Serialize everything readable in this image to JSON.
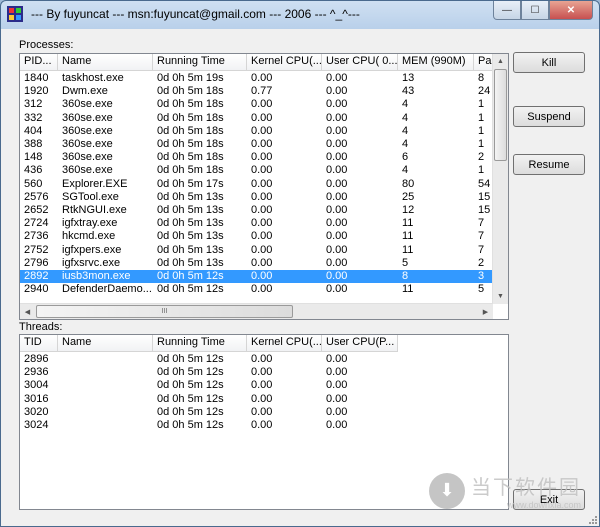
{
  "window": {
    "title": "--- By fuyuncat --- msn:fuyuncat@gmail.com --- 2006 --- ^_^---",
    "icon": "app-icon",
    "minimize_glyph": "—",
    "maximize_glyph": "☐",
    "close_glyph": "✕"
  },
  "processes": {
    "label": "Processes:",
    "columns": [
      "PID...",
      "Name",
      "Running Time",
      "Kernel CPU(...",
      "User CPU( 0...",
      "MEM (990M)",
      "Pa"
    ],
    "rows": [
      [
        "1840",
        "taskhost.exe",
        "0d 0h 5m 19s",
        "0.00",
        "0.00",
        "13",
        "8"
      ],
      [
        "1920",
        "Dwm.exe",
        "0d 0h 5m 18s",
        "0.77",
        "0.00",
        "43",
        "24"
      ],
      [
        "312",
        "360se.exe",
        "0d 0h 5m 18s",
        "0.00",
        "0.00",
        "4",
        "1"
      ],
      [
        "332",
        "360se.exe",
        "0d 0h 5m 18s",
        "0.00",
        "0.00",
        "4",
        "1"
      ],
      [
        "404",
        "360se.exe",
        "0d 0h 5m 18s",
        "0.00",
        "0.00",
        "4",
        "1"
      ],
      [
        "388",
        "360se.exe",
        "0d 0h 5m 18s",
        "0.00",
        "0.00",
        "4",
        "1"
      ],
      [
        "148",
        "360se.exe",
        "0d 0h 5m 18s",
        "0.00",
        "0.00",
        "6",
        "2"
      ],
      [
        "436",
        "360se.exe",
        "0d 0h 5m 18s",
        "0.00",
        "0.00",
        "4",
        "1"
      ],
      [
        "560",
        "Explorer.EXE",
        "0d 0h 5m 17s",
        "0.00",
        "0.00",
        "80",
        "54"
      ],
      [
        "2576",
        "SGTool.exe",
        "0d 0h 5m 13s",
        "0.00",
        "0.00",
        "25",
        "15"
      ],
      [
        "2652",
        "RtkNGUI.exe",
        "0d 0h 5m 13s",
        "0.00",
        "0.00",
        "12",
        "15"
      ],
      [
        "2724",
        "igfxtray.exe",
        "0d 0h 5m 13s",
        "0.00",
        "0.00",
        "11",
        "7"
      ],
      [
        "2736",
        "hkcmd.exe",
        "0d 0h 5m 13s",
        "0.00",
        "0.00",
        "11",
        "7"
      ],
      [
        "2752",
        "igfxpers.exe",
        "0d 0h 5m 13s",
        "0.00",
        "0.00",
        "11",
        "7"
      ],
      [
        "2796",
        "igfxsrvc.exe",
        "0d 0h 5m 13s",
        "0.00",
        "0.00",
        "5",
        "2"
      ],
      [
        "2892",
        "iusb3mon.exe",
        "0d 0h 5m 12s",
        "0.00",
        "0.00",
        "8",
        "3"
      ],
      [
        "2940",
        "DefenderDaemo...",
        "0d 0h 5m 12s",
        "0.00",
        "0.00",
        "11",
        "5"
      ]
    ],
    "selected_index": 15,
    "hscroll_grip": "III"
  },
  "threads": {
    "label": "Threads:",
    "columns": [
      "TID",
      "Name",
      "Running Time",
      "Kernel CPU(...",
      "User CPU(P..."
    ],
    "rows": [
      [
        "2896",
        "",
        "0d 0h 5m 12s",
        "0.00",
        "0.00"
      ],
      [
        "2936",
        "",
        "0d 0h 5m 12s",
        "0.00",
        "0.00"
      ],
      [
        "3004",
        "",
        "0d 0h 5m 12s",
        "0.00",
        "0.00"
      ],
      [
        "3016",
        "",
        "0d 0h 5m 12s",
        "0.00",
        "0.00"
      ],
      [
        "3020",
        "",
        "0d 0h 5m 12s",
        "0.00",
        "0.00"
      ],
      [
        "3024",
        "",
        "0d 0h 5m 12s",
        "0.00",
        "0.00"
      ]
    ]
  },
  "buttons": {
    "kill": "Kill",
    "suspend": "Suspend",
    "resume": "Resume",
    "exit": "Exit"
  },
  "watermark": {
    "text": "当下软件园",
    "url": "www.downxia.com",
    "icon": "download-arrow-icon"
  },
  "colors": {
    "selection": "#3399ff",
    "title_bar": "#b9d0ea",
    "close_button": "#c75050"
  }
}
